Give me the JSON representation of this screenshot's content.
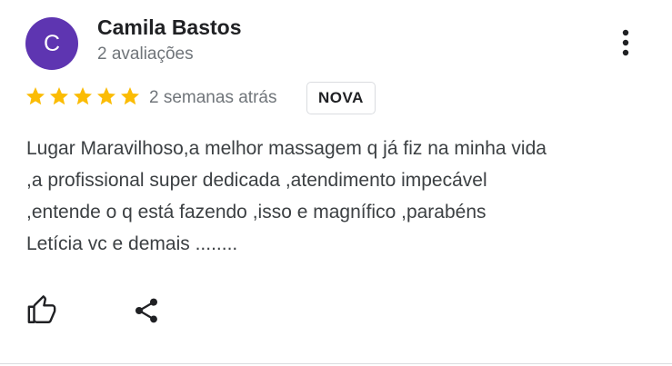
{
  "review": {
    "author_initial": "C",
    "author_name": "Camila Bastos",
    "review_count": "2 avaliações",
    "rating": 5,
    "rating_max": 5,
    "time": "2 semanas atrás",
    "badge": "NOVA",
    "text_lines": [
      "Lugar Maravilhoso,a melhor massagem q já fiz na minha vida",
      ",a profissional super dedicada ,atendimento impecável",
      ",entende o q está fazendo ,isso e magnífico ,parabéns",
      "Letícia vc e demais ........"
    ]
  },
  "colors": {
    "avatar_bg": "#5e35b1",
    "star": "#fbbc04",
    "text_primary": "#202124",
    "text_secondary": "#70757a"
  },
  "icons": {
    "menu": "more-vert-icon",
    "like": "thumbs-up-icon",
    "share": "share-icon",
    "star": "star-icon"
  }
}
